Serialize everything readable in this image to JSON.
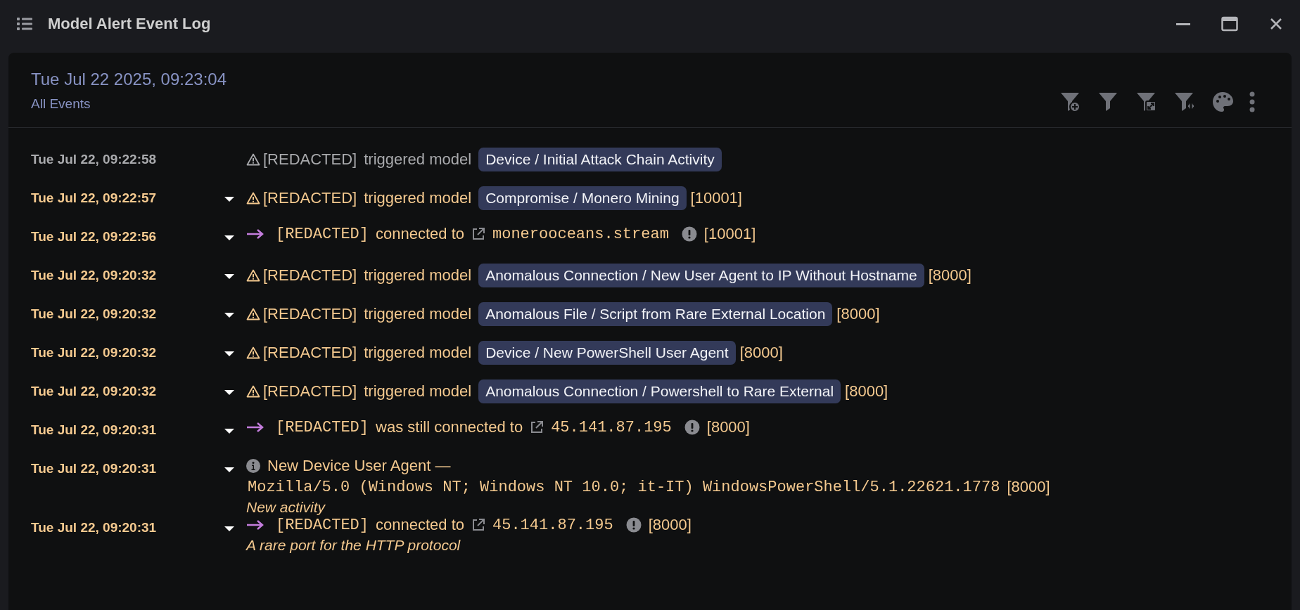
{
  "window": {
    "title": "Model Alert Event Log"
  },
  "header": {
    "timestamp": "Tue Jul 22 2025, 09:23:04",
    "filter_label": "All Events"
  },
  "events": [
    {
      "kind": "model",
      "active": false,
      "time": "Tue Jul 22, 09:22:58",
      "device": "[REDACTED]",
      "verb": "triggered model",
      "model": "Device / Initial Attack Chain Activity"
    },
    {
      "kind": "model",
      "active": true,
      "time": "Tue Jul 22, 09:22:57",
      "device": "[REDACTED]",
      "verb": "triggered model",
      "model": "Compromise / Monero Mining",
      "score": "[10001]"
    },
    {
      "kind": "connection",
      "active": true,
      "time": "Tue Jul 22, 09:22:56",
      "device": "[REDACTED]",
      "verb": "connected to",
      "target": "monerooceans.stream",
      "score": "[10001]"
    },
    {
      "kind": "model",
      "active": true,
      "time": "Tue Jul 22, 09:20:32",
      "device": "[REDACTED]",
      "verb": "triggered model",
      "model": "Anomalous Connection / New User Agent to IP Without Hostname",
      "score": "[8000]"
    },
    {
      "kind": "model",
      "active": true,
      "time": "Tue Jul 22, 09:20:32",
      "device": "[REDACTED]",
      "verb": "triggered model",
      "model": "Anomalous File / Script from Rare External Location",
      "score": "[8000]"
    },
    {
      "kind": "model",
      "active": true,
      "time": "Tue Jul 22, 09:20:32",
      "device": "[REDACTED]",
      "verb": "triggered model",
      "model": "Device / New PowerShell User Agent",
      "score": "[8000]"
    },
    {
      "kind": "model",
      "active": true,
      "time": "Tue Jul 22, 09:20:32",
      "device": "[REDACTED]",
      "verb": "triggered model",
      "model": "Anomalous Connection / Powershell to Rare External",
      "score": "[8000]"
    },
    {
      "kind": "connection",
      "active": true,
      "time": "Tue Jul 22, 09:20:31",
      "device": "[REDACTED]",
      "verb": "was still connected to",
      "target": "45.141.87.195",
      "score": "[8000]"
    },
    {
      "kind": "info",
      "active": true,
      "time": "Tue Jul 22, 09:20:31",
      "title": "New Device User Agent —",
      "code": "Mozilla/5.0 (Windows NT; Windows NT 10.0; it-IT) WindowsPowerShell/5.1.22621.1778",
      "score": "[8000]",
      "note": "New activity"
    },
    {
      "kind": "connection",
      "active": true,
      "time": "Tue Jul 22, 09:20:31",
      "device": "[REDACTED]",
      "verb": "connected to",
      "target": "45.141.87.195",
      "score": "[8000]",
      "note": "A rare port for the HTTP protocol"
    }
  ]
}
